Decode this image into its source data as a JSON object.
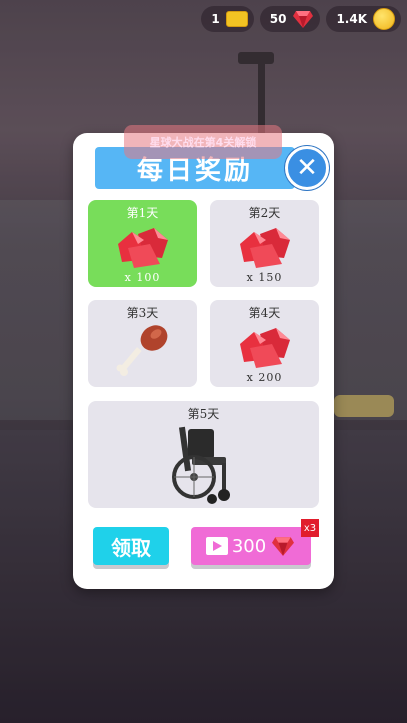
{
  "topbar": {
    "tickets": "1",
    "gems": "50",
    "coins": "1.4K"
  },
  "toast": "星球大战在第4关解锁",
  "dialog": {
    "title": "每日奖励",
    "close_icon": "close-icon",
    "days": [
      {
        "label": "第1天",
        "reward": "gems",
        "qty": "x 100",
        "active": true
      },
      {
        "label": "第2天",
        "reward": "gems",
        "qty": "x 150",
        "active": false
      },
      {
        "label": "第3天",
        "reward": "drumstick",
        "qty": "",
        "active": false
      },
      {
        "label": "第4天",
        "reward": "gems",
        "qty": "x 200",
        "active": false
      },
      {
        "label": "第5天",
        "reward": "wheelchair",
        "qty": "",
        "active": false
      }
    ],
    "claim_label": "领取",
    "video_amount": "300",
    "video_badge": "x3"
  },
  "colors": {
    "active_card": "#78dd5a",
    "header": "#56b6f5",
    "claim": "#1fd1ea",
    "video": "#f06bd6"
  }
}
